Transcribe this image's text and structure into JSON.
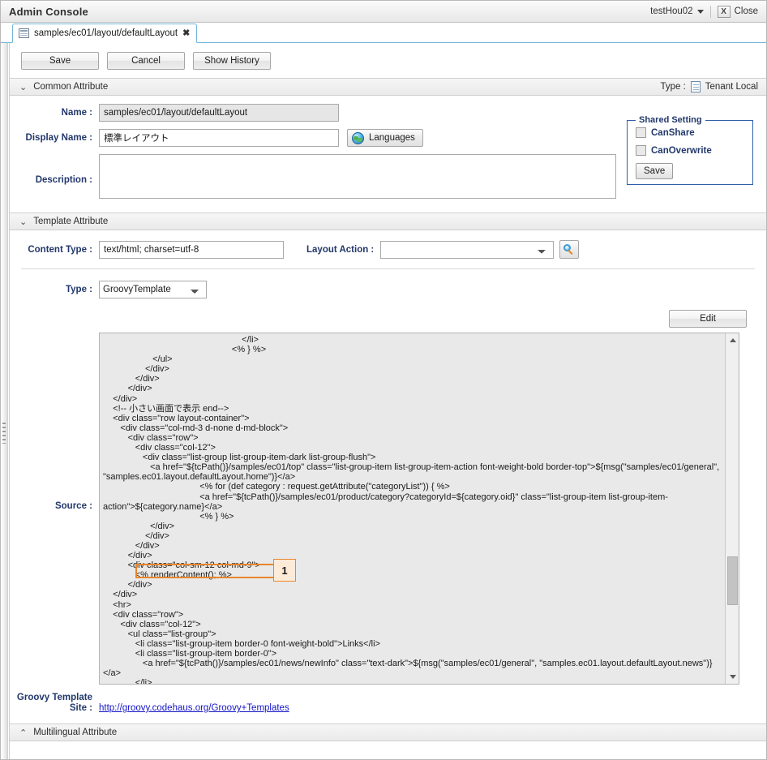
{
  "titlebar": {
    "app_title": "Admin Console",
    "user": "testHou02",
    "close_x": "X",
    "close_label": "Close"
  },
  "tab": {
    "label": "samples/ec01/layout/defaultLayout",
    "close_glyph": "✖"
  },
  "toolbar": {
    "save_label": "Save",
    "cancel_label": "Cancel",
    "show_history_label": "Show History"
  },
  "common_attribute": {
    "header": "Common Attribute",
    "chevron": "⌄",
    "type_label": "Type :",
    "type_value": "Tenant Local",
    "name_label": "Name :",
    "name_value": "samples/ec01/layout/defaultLayout",
    "display_name_label": "Display Name :",
    "display_name_value": "標準レイアウト",
    "languages_button": "Languages",
    "description_label": "Description :",
    "description_value": "",
    "shared_setting": {
      "legend": "Shared Setting",
      "can_share_label": "CanShare",
      "can_share_checked": false,
      "can_overwrite_label": "CanOverwrite",
      "can_overwrite_checked": false,
      "save_label": "Save"
    }
  },
  "template_attribute": {
    "header": "Template Attribute",
    "chevron": "⌄",
    "content_type_label": "Content Type :",
    "content_type_value": "text/html; charset=utf-8",
    "layout_action_label": "Layout Action :",
    "layout_action_value": "",
    "type_label": "Type :",
    "type_value": "GroovyTemplate",
    "edit_label": "Edit",
    "source_label": "Source :",
    "source_code": "                                                        </li>\n                                                    <% } %>\n                    </ul>\n                 </div>\n             </div>\n          </div>\n    </div>\n    <!-- 小さい画面で表示 end-->\n    <div class=\"row layout-container\">\n       <div class=\"col-md-3 d-none d-md-block\">\n          <div class=\"row\">\n             <div class=\"col-12\">\n                <div class=\"list-group list-group-item-dark list-group-flush\">\n                   <a href=\"${tcPath()}/samples/ec01/top\" class=\"list-group-item list-group-item-action font-weight-bold border-top\">${msg(\"samples/ec01/general\", \"samples.ec01.layout.defaultLayout.home\")}</a>\n                                       <% for (def category : request.getAttribute(\"categoryList\")) { %>\n                                       <a href=\"${tcPath()}/samples/ec01/product/category?categoryId=${category.oid}\" class=\"list-group-item list-group-item-action\">${category.name}</a>\n                                       <% } %>\n                   </div>\n                 </div>\n             </div>\n          </div>\n          <div class=\"col-sm-12 col-md-9\">\n             <% renderContent(); %>\n          </div>\n    </div>\n    <hr>\n    <div class=\"row\">\n       <div class=\"col-12\">\n          <ul class=\"list-group\">\n             <li class=\"list-group-item border-0 font-weight-bold\">Links</li>\n             <li class=\"list-group-item border-0\">\n                <a href=\"${tcPath()}/samples/ec01/news/newInfo\" class=\"text-dark\">${msg(\"samples/ec01/general\", \"samples.ec01.layout.defaultLayout.news\")}</a>\n             </li>",
    "annotation_number": "1",
    "groovy_site_label_line1": "Groovy Template",
    "groovy_site_label_line2": "Site :",
    "groovy_site_url": "http://groovy.codehaus.org/Groovy+Templates"
  },
  "multilingual_attribute": {
    "header": "Multilingual Attribute",
    "chevron": "⌃"
  }
}
